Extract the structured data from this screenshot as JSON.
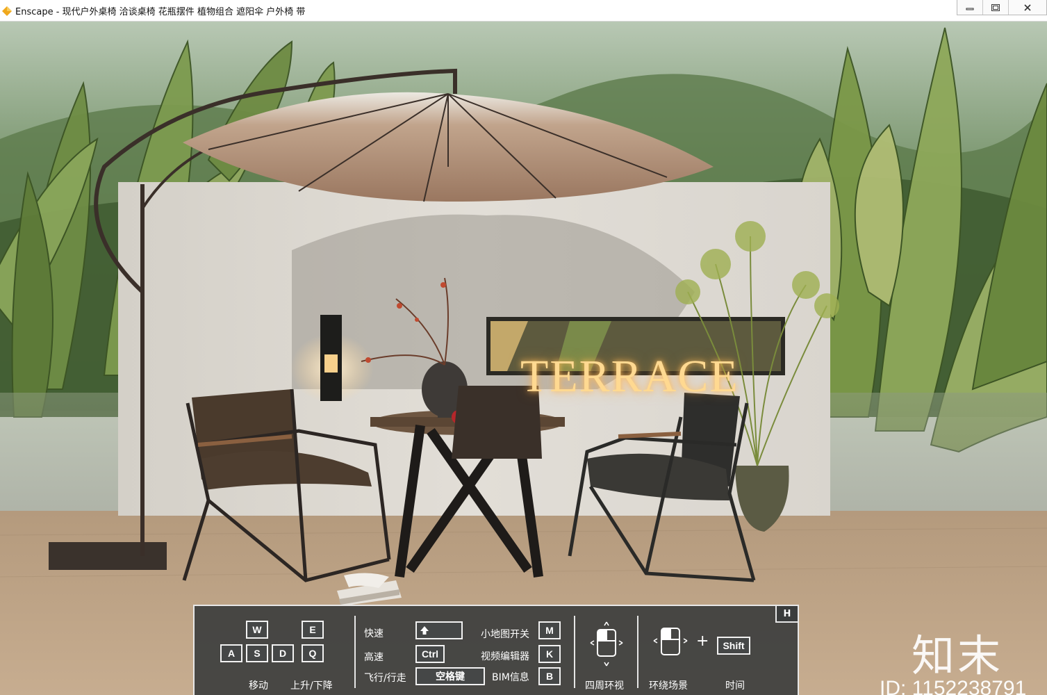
{
  "window": {
    "app_name": "Enscape",
    "title": "Enscape - 现代户外桌椅 洽谈桌椅 花瓶摆件 植物组合 遮阳伞 户外椅 带",
    "controls": [
      "minimize-icon",
      "restore-icon",
      "close-icon"
    ]
  },
  "scene": {
    "sign_text": "TERRACE",
    "watermark_logo": "知末",
    "watermark_id": "ID: 1152238791"
  },
  "help_panel": {
    "toggle_key": "H",
    "movement_keys": {
      "w": "W",
      "e": "E",
      "a": "A",
      "s": "S",
      "d": "D",
      "q": "Q",
      "move_label": "移动",
      "updown_label": "上升/下降"
    },
    "speed": {
      "fast_label": "快速",
      "faster_label": "高速",
      "fly_walk_label": "飞行/行走",
      "ctrl_key": "Ctrl",
      "space_key": "空格键",
      "shift_key_icon": "shift-arrow-icon"
    },
    "toggles": {
      "minimap_label": "小地图开关",
      "minimap_key": "M",
      "video_editor_label": "视频编辑器",
      "video_editor_key": "K",
      "bim_label": "BIM信息",
      "bim_key": "B"
    },
    "look_around_label": "四周环视",
    "orbit_label": "环绕场景",
    "plus": "+",
    "time_key": "Shift",
    "time_label": "时间"
  },
  "colors": {
    "panel_bg": "#3a3c3c",
    "panel_border": "#e8e8e8",
    "sign_glow": "#ffd991",
    "umbrella": "#a37f66"
  }
}
